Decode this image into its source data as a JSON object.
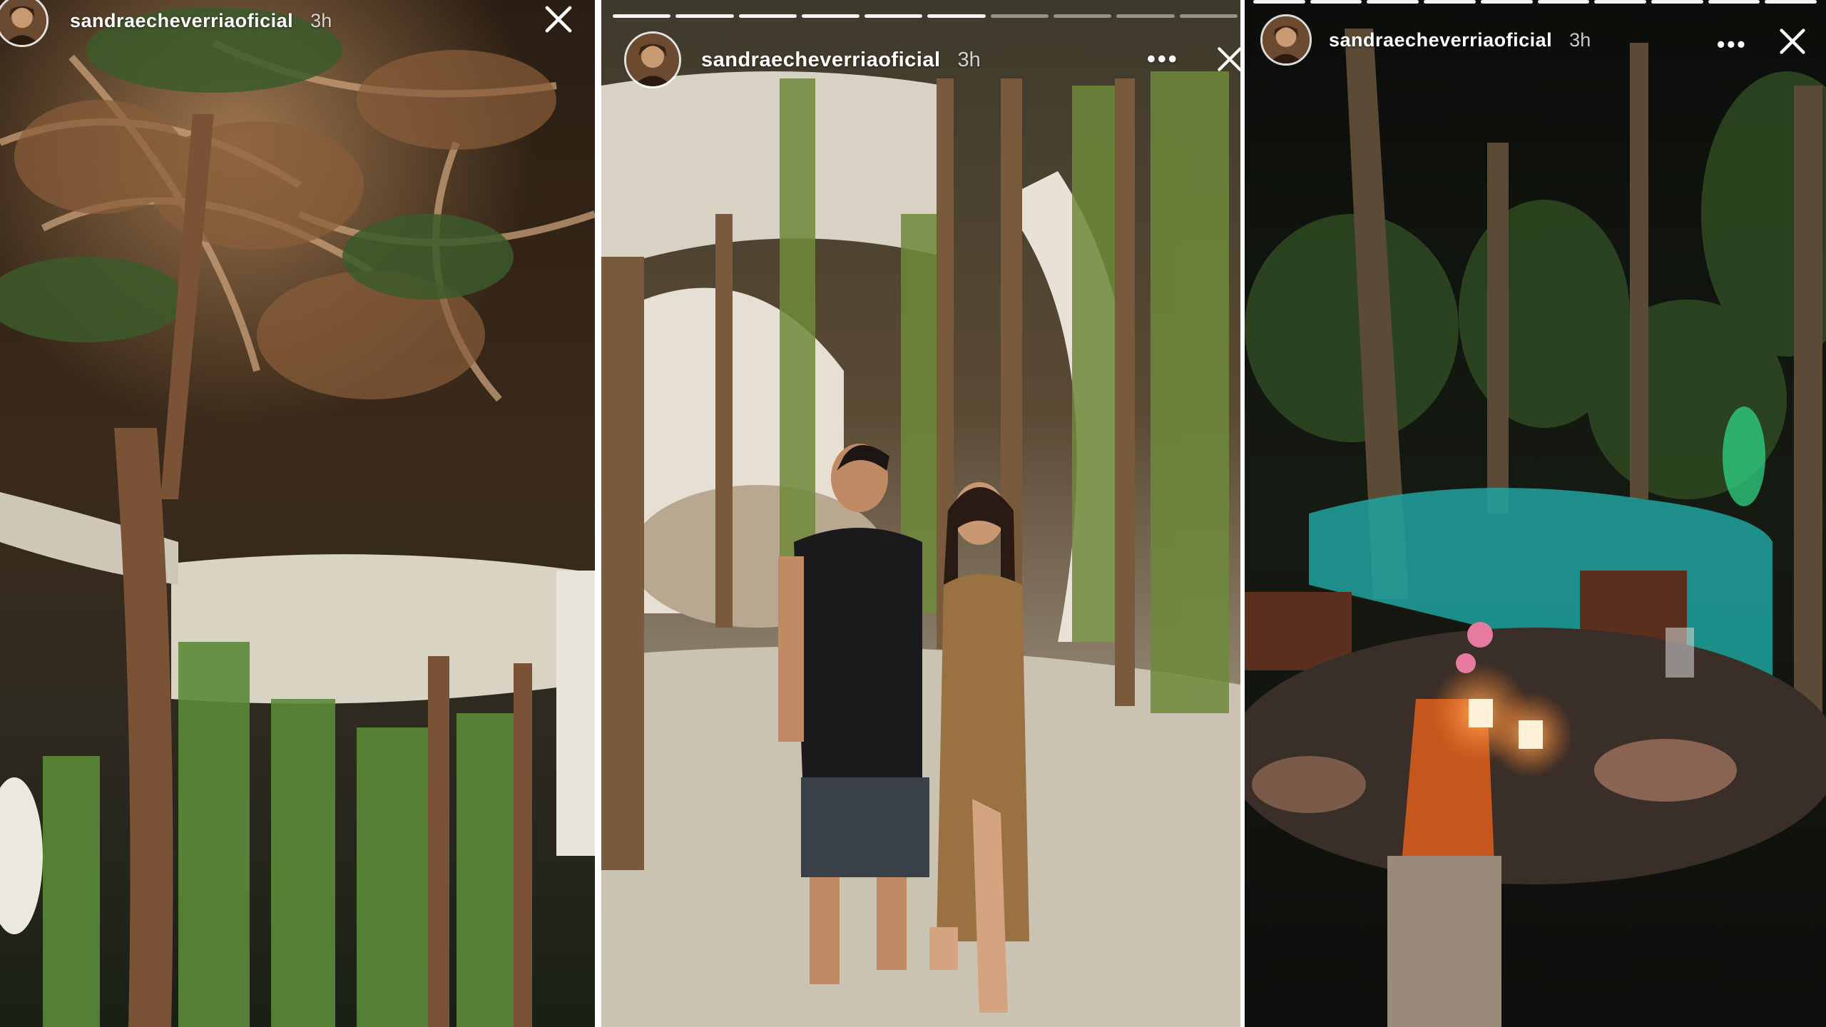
{
  "stories": [
    {
      "username": "sandraecheverriaoficial",
      "time": "3h",
      "progress_total": 0,
      "progress_current": 0,
      "icons": [
        "avatar",
        "close-icon"
      ]
    },
    {
      "username": "sandraecheverriaoficial",
      "time": "3h",
      "progress_total": 10,
      "progress_current": 6,
      "icons": [
        "avatar",
        "more-icon",
        "close-icon"
      ]
    },
    {
      "username": "sandraecheverriaoficial",
      "time": "3h",
      "progress_total": 10,
      "progress_current": 10,
      "icons": [
        "avatar",
        "more-icon",
        "close-icon"
      ]
    }
  ],
  "more_label": "•••",
  "colors": {
    "header_text": "#ffffff",
    "progress_done": "#f2f2f2",
    "progress_pending": "#9a9a9a",
    "pool": "#1fa3a0",
    "candle": "#ff9a3c"
  }
}
